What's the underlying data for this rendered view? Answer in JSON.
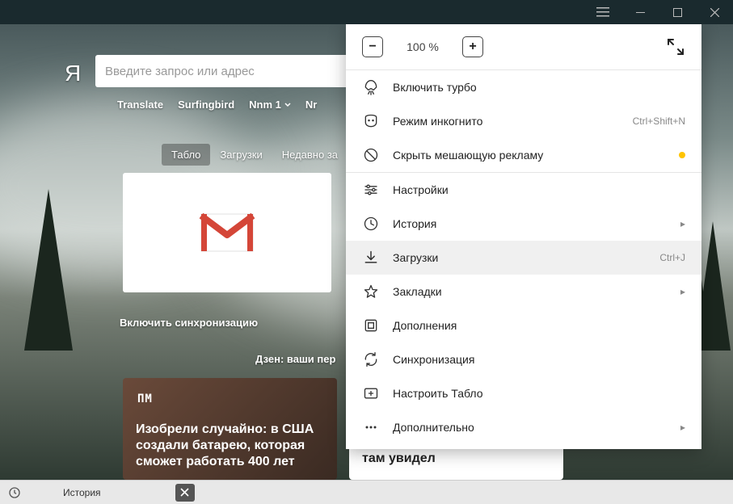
{
  "titlebar": {
    "icons": {
      "hamburger": "menu",
      "minimize": "minimize",
      "maximize": "maximize",
      "close": "close"
    }
  },
  "page": {
    "logo": "Я",
    "search_placeholder": "Введите запрос или адрес",
    "bookmarks": [
      "Translate",
      "Surfingbird",
      "Nnm 1",
      "Nr"
    ],
    "tabs": {
      "tablo": "Табло",
      "downloads": "Загрузки",
      "recent": "Недавно за"
    },
    "active_tab": "tablo",
    "tile_label": "Gmail",
    "sync_label": "Включить синхронизацию",
    "zen_label": "Дзен: ваши пер"
  },
  "cards": [
    {
      "source": "ПМ",
      "headline": "Изобрели случайно: в США создали батарею, которая сможет работать 400 лет"
    },
    {
      "source": "",
      "headline": "Этот парень попал в первый класс самолета. И вот что он там увидел"
    }
  ],
  "menu": {
    "zoom": {
      "value": "100 %",
      "minus": "−",
      "plus": "+"
    },
    "items": [
      {
        "id": "turbo",
        "icon": "rocket",
        "label": "Включить турбо",
        "shortcut": "",
        "chevron": false,
        "dot": false
      },
      {
        "id": "incognito",
        "icon": "mask",
        "label": "Режим инкогнито",
        "shortcut": "Ctrl+Shift+N",
        "chevron": false,
        "dot": false
      },
      {
        "id": "hideads",
        "icon": "block",
        "label": "Скрыть мешающую рекламу",
        "shortcut": "",
        "chevron": false,
        "dot": true
      }
    ],
    "items2": [
      {
        "id": "settings",
        "icon": "sliders",
        "label": "Настройки",
        "shortcut": "",
        "chevron": false
      },
      {
        "id": "history",
        "icon": "clock",
        "label": "История",
        "shortcut": "",
        "chevron": true
      },
      {
        "id": "downloads",
        "icon": "download",
        "label": "Загрузки",
        "shortcut": "Ctrl+J",
        "chevron": false,
        "highlighted": true
      },
      {
        "id": "bookmarks",
        "icon": "star",
        "label": "Закладки",
        "shortcut": "",
        "chevron": true
      },
      {
        "id": "extensions",
        "icon": "extensions",
        "label": "Дополнения",
        "shortcut": "",
        "chevron": false
      },
      {
        "id": "sync",
        "icon": "sync",
        "label": "Синхронизация",
        "shortcut": "",
        "chevron": false
      },
      {
        "id": "configtablo",
        "icon": "addtile",
        "label": "Настроить Табло",
        "shortcut": "",
        "chevron": false
      },
      {
        "id": "more",
        "icon": "dots",
        "label": "Дополнительно",
        "shortcut": "",
        "chevron": true
      }
    ]
  },
  "bottombar": {
    "label": "История",
    "close": "×"
  },
  "colors": {
    "accent_yellow": "#ffc400",
    "text": "#222222"
  }
}
